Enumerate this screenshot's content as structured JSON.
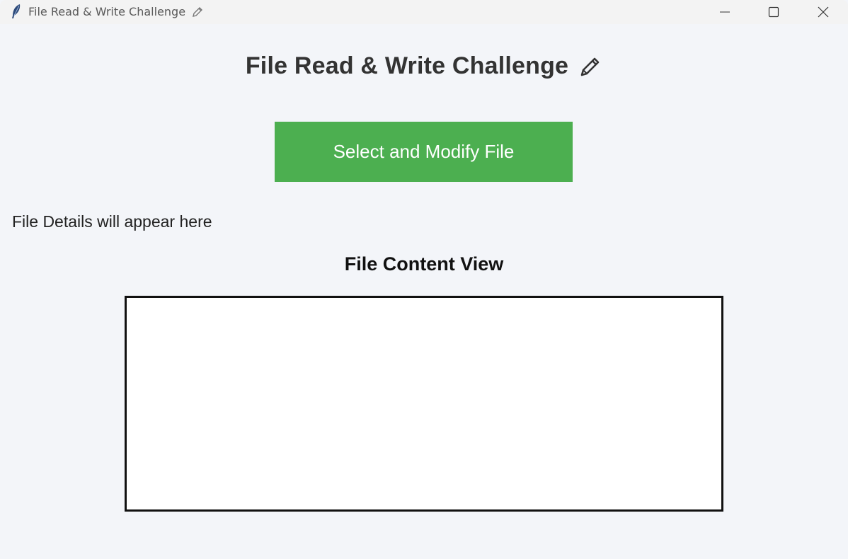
{
  "window": {
    "title": "File Read & Write Challenge",
    "app_icon": "feather-icon",
    "title_icon": "pencil-icon",
    "controls": {
      "minimize": "minimize-icon",
      "maximize": "maximize-icon",
      "close": "close-icon"
    }
  },
  "main": {
    "heading": "File Read & Write Challenge",
    "heading_icon": "pencil-icon",
    "select_button_label": "Select and Modify File",
    "details_text": "File Details will appear here",
    "content_label": "File Content View",
    "content_text": ""
  },
  "colors": {
    "background": "#f3f5f9",
    "button": "#4caf50",
    "button_text": "#ffffff",
    "heading_text": "#333333"
  }
}
